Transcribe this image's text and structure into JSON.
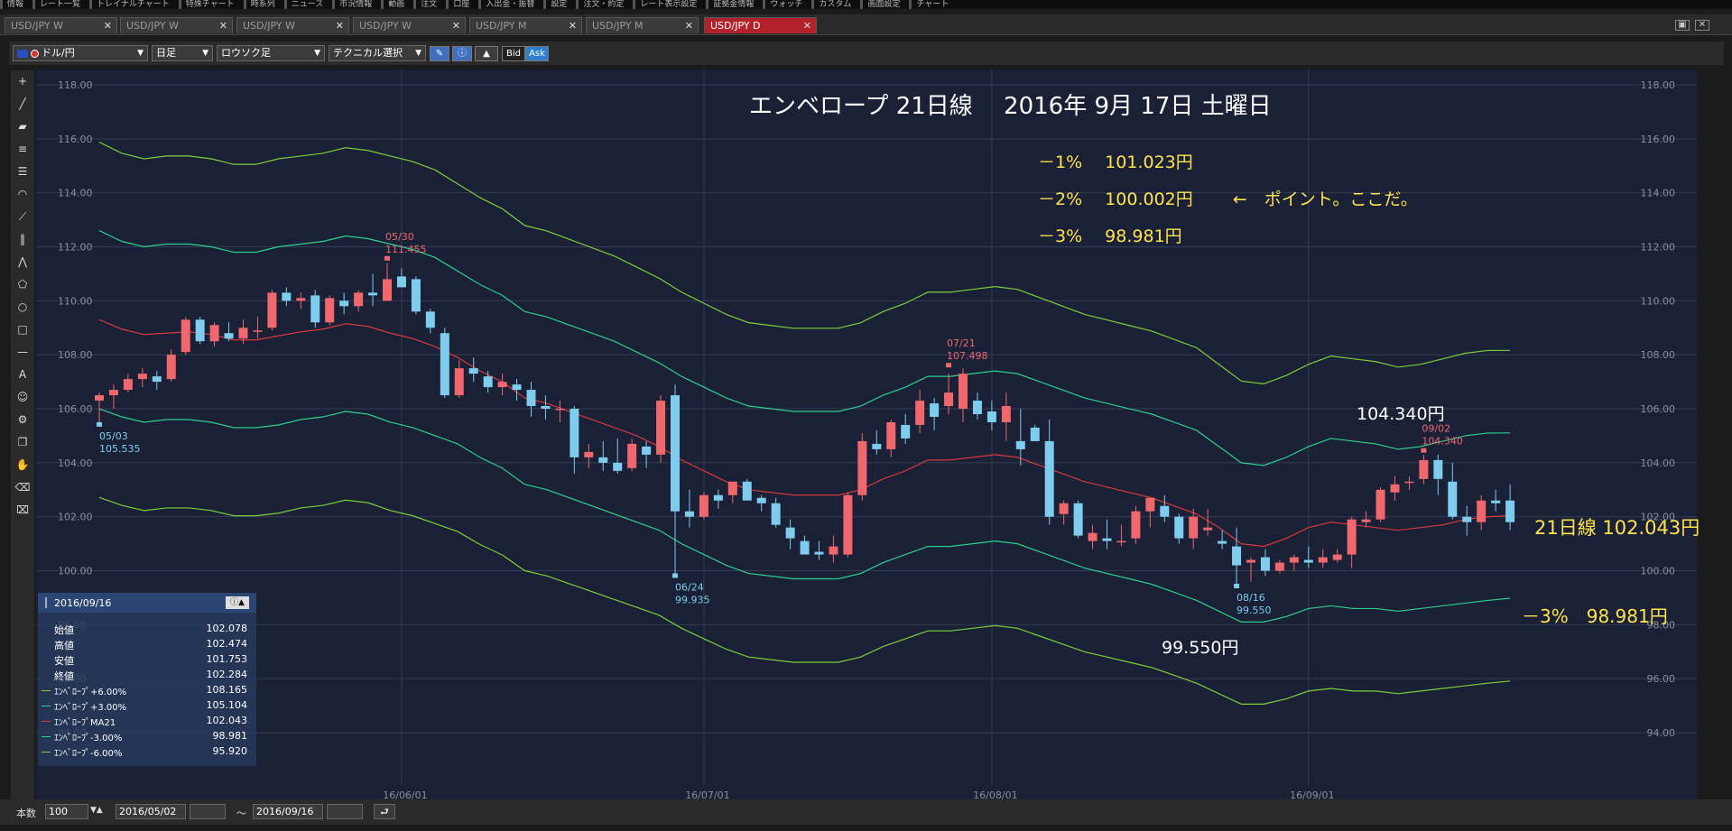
{
  "menubar": {
    "items": [
      "情報",
      "レート一覧",
      "トレイナルチャート",
      "特殊チャート",
      "時系列",
      "ニュース",
      "市況情報",
      "動画",
      "注文",
      "口座",
      "入出金・振替",
      "設定",
      "注文・約定",
      "レート表示設定",
      "証拠金情報",
      "ウォッチ",
      "カスタム",
      "画面設定",
      "チャート"
    ]
  },
  "tabs": [
    {
      "label": "USD/JPY W"
    },
    {
      "label": "USD/JPY W"
    },
    {
      "label": "USD/JPY W"
    },
    {
      "label": "USD/JPY W"
    },
    {
      "label": "USD/JPY M"
    },
    {
      "label": "USD/JPY M"
    },
    {
      "label": "USD/JPY D",
      "active": true
    }
  ],
  "toolbar": {
    "pair": "ドル/円",
    "period": "日足",
    "chart_style": "ロウソク足",
    "technical": "テクニカル選択",
    "bid": "Bid",
    "ask": "Ask"
  },
  "bottombar": {
    "count_label": "本数",
    "count_value": "100",
    "from_date": "2016/05/02",
    "tilde": "～",
    "to_date": "2016/09/16"
  },
  "info_panel": {
    "date": "2016/09/16",
    "rows": [
      {
        "label": "始値",
        "value": "102.078"
      },
      {
        "label": "高値",
        "value": "102.474"
      },
      {
        "label": "安値",
        "value": "101.753"
      },
      {
        "label": "終値",
        "value": "102.284"
      },
      {
        "label": "ｴﾝﾍﾞﾛｰﾌﾟ+6.00%",
        "value": "108.165",
        "color": "#7ccf3a"
      },
      {
        "label": "ｴﾝﾍﾞﾛｰﾌﾟ+3.00%",
        "value": "105.104",
        "color": "#2ecf8c"
      },
      {
        "label": "ｴﾝﾍﾞﾛｰﾌﾟMA21",
        "value": "102.043",
        "color": "#d63a3a"
      },
      {
        "label": "ｴﾝﾍﾞﾛｰﾌﾟ-3.00%",
        "value": "98.981",
        "color": "#2ecf8c"
      },
      {
        "label": "ｴﾝﾍﾞﾛｰﾌﾟ-6.00%",
        "value": "95.920",
        "color": "#7ccf3a"
      }
    ]
  },
  "annotations": {
    "title": "エンベロープ 21日線　 2016年 9月 17日 土曜日",
    "line1": "－1%　 101.023円",
    "line2": "－2%　 100.002円　　 ←　ポイント。ここだ。",
    "line3": "－3%　 98.981円",
    "high_label": "104.340円",
    "low_label": "99.550円",
    "ma_label": "21日線 102.043円",
    "minus3_label": "－3%　98.981円"
  },
  "chart_data": {
    "type": "candlestick",
    "title": "",
    "ylim": [
      93.2,
      118.2
    ],
    "y_ticks": [
      "118.00",
      "116.00",
      "114.00",
      "112.00",
      "110.00",
      "108.00",
      "106.00",
      "104.00",
      "102.00",
      "100.00",
      "98.00",
      "96.00",
      "94.00"
    ],
    "x_ticks": [
      {
        "label": "16/06/01",
        "index": 21
      },
      {
        "label": "16/07/01",
        "index": 42
      },
      {
        "label": "16/08/01",
        "index": 62
      },
      {
        "label": "16/09/01",
        "index": 84
      }
    ],
    "grid": true,
    "colors": {
      "up": "#f0686e",
      "down": "#7ecdee",
      "ma21": "#d63a3a",
      "env3": "#2ecf8c",
      "env6": "#7ccf3a"
    },
    "ohlc": [
      [
        106.3,
        106.6,
        105.5,
        106.5
      ],
      [
        106.5,
        106.9,
        106.0,
        106.7
      ],
      [
        106.7,
        107.3,
        106.6,
        107.1
      ],
      [
        107.1,
        107.5,
        106.8,
        107.3
      ],
      [
        107.2,
        107.4,
        106.7,
        107.0
      ],
      [
        107.1,
        108.2,
        107.0,
        108.0
      ],
      [
        108.1,
        109.4,
        108.0,
        109.3
      ],
      [
        109.3,
        109.4,
        108.4,
        108.5
      ],
      [
        108.5,
        109.2,
        108.3,
        109.1
      ],
      [
        108.8,
        109.2,
        108.5,
        108.6
      ],
      [
        108.6,
        109.3,
        108.4,
        109.0
      ],
      [
        108.9,
        109.4,
        108.6,
        108.9
      ],
      [
        109.0,
        110.4,
        108.9,
        110.3
      ],
      [
        110.3,
        110.5,
        109.8,
        110.0
      ],
      [
        110.0,
        110.3,
        109.7,
        110.1
      ],
      [
        110.2,
        110.4,
        109.0,
        109.2
      ],
      [
        109.2,
        110.2,
        109.1,
        110.1
      ],
      [
        110.0,
        110.3,
        109.5,
        109.8
      ],
      [
        109.8,
        110.4,
        109.6,
        110.3
      ],
      [
        110.3,
        111.0,
        109.8,
        110.2
      ],
      [
        110.0,
        111.4,
        110.0,
        110.8
      ],
      [
        110.9,
        111.2,
        110.5,
        110.5
      ],
      [
        110.8,
        110.9,
        109.5,
        109.6
      ],
      [
        109.6,
        109.7,
        108.8,
        109.0
      ],
      [
        108.8,
        109.0,
        106.4,
        106.5
      ],
      [
        106.5,
        107.8,
        106.4,
        107.5
      ],
      [
        107.5,
        107.9,
        107.0,
        107.3
      ],
      [
        107.2,
        107.4,
        106.6,
        106.8
      ],
      [
        106.8,
        107.3,
        106.5,
        107.0
      ],
      [
        106.9,
        107.1,
        106.3,
        106.7
      ],
      [
        106.7,
        107.0,
        105.7,
        106.1
      ],
      [
        106.1,
        106.5,
        105.6,
        106.0
      ],
      [
        106.0,
        106.3,
        105.5,
        106.0
      ],
      [
        106.0,
        106.1,
        103.6,
        104.2
      ],
      [
        104.2,
        104.7,
        103.8,
        104.4
      ],
      [
        104.2,
        104.8,
        103.7,
        104.0
      ],
      [
        104.0,
        104.9,
        103.6,
        103.7
      ],
      [
        103.8,
        104.9,
        103.7,
        104.7
      ],
      [
        104.6,
        104.8,
        103.8,
        104.3
      ],
      [
        104.3,
        106.5,
        104.0,
        106.3
      ],
      [
        106.5,
        106.9,
        99.9,
        102.2
      ],
      [
        102.2,
        103.0,
        101.6,
        102.0
      ],
      [
        102.0,
        102.9,
        101.9,
        102.8
      ],
      [
        102.8,
        103.0,
        102.3,
        102.6
      ],
      [
        102.8,
        103.3,
        102.5,
        103.3
      ],
      [
        103.3,
        103.4,
        102.6,
        102.6
      ],
      [
        102.7,
        102.8,
        102.2,
        102.5
      ],
      [
        102.5,
        102.7,
        101.6,
        101.7
      ],
      [
        101.6,
        101.9,
        100.8,
        101.2
      ],
      [
        101.1,
        101.3,
        100.6,
        100.6
      ],
      [
        100.7,
        101.1,
        100.4,
        100.6
      ],
      [
        100.6,
        101.3,
        100.3,
        100.9
      ],
      [
        100.6,
        102.9,
        100.5,
        102.8
      ],
      [
        102.8,
        105.1,
        102.6,
        104.8
      ],
      [
        104.7,
        105.2,
        104.3,
        104.5
      ],
      [
        104.5,
        105.6,
        104.2,
        105.5
      ],
      [
        105.4,
        105.8,
        104.7,
        104.9
      ],
      [
        105.4,
        106.7,
        105.1,
        106.3
      ],
      [
        106.2,
        106.4,
        105.2,
        105.7
      ],
      [
        106.1,
        107.3,
        105.8,
        106.6
      ],
      [
        106.0,
        107.5,
        105.5,
        107.3
      ],
      [
        106.3,
        106.6,
        105.6,
        105.8
      ],
      [
        105.9,
        106.3,
        105.2,
        105.5
      ],
      [
        105.5,
        106.6,
        104.8,
        106.1
      ],
      [
        104.8,
        106.0,
        103.9,
        104.5
      ],
      [
        105.3,
        105.4,
        104.8,
        104.8
      ],
      [
        104.8,
        105.6,
        101.7,
        102.0
      ],
      [
        102.1,
        102.6,
        101.7,
        102.5
      ],
      [
        102.5,
        102.6,
        101.2,
        101.3
      ],
      [
        101.1,
        101.7,
        100.8,
        101.4
      ],
      [
        101.2,
        101.9,
        100.8,
        101.1
      ],
      [
        101.1,
        101.7,
        100.9,
        101.1
      ],
      [
        101.2,
        102.4,
        101.0,
        102.2
      ],
      [
        102.2,
        102.6,
        101.6,
        102.7
      ],
      [
        102.4,
        102.8,
        101.8,
        102.0
      ],
      [
        102.0,
        102.1,
        101.0,
        101.2
      ],
      [
        101.2,
        102.3,
        100.8,
        102.0
      ],
      [
        101.5,
        102.3,
        101.3,
        101.6
      ],
      [
        101.1,
        101.5,
        100.8,
        101.0
      ],
      [
        100.9,
        101.6,
        99.5,
        100.2
      ],
      [
        100.3,
        100.5,
        99.6,
        100.4
      ],
      [
        100.5,
        100.8,
        99.8,
        100.0
      ],
      [
        100.0,
        100.4,
        99.9,
        100.3
      ],
      [
        100.3,
        100.6,
        100.0,
        100.5
      ],
      [
        100.4,
        100.9,
        100.1,
        100.3
      ],
      [
        100.3,
        100.8,
        100.1,
        100.5
      ],
      [
        100.4,
        100.8,
        100.3,
        100.6
      ],
      [
        100.6,
        102.0,
        100.1,
        101.9
      ],
      [
        101.8,
        102.2,
        101.6,
        101.9
      ],
      [
        101.9,
        103.1,
        101.8,
        103.0
      ],
      [
        102.9,
        103.5,
        102.6,
        103.2
      ],
      [
        103.3,
        103.5,
        103.0,
        103.3
      ],
      [
        103.4,
        104.3,
        103.2,
        104.1
      ],
      [
        104.1,
        104.3,
        102.8,
        103.4
      ],
      [
        103.3,
        104.0,
        101.9,
        102.0
      ],
      [
        102.0,
        102.4,
        101.3,
        101.8
      ],
      [
        101.8,
        102.8,
        101.5,
        102.6
      ],
      [
        102.6,
        103.0,
        102.2,
        102.5
      ],
      [
        102.6,
        103.2,
        101.5,
        101.8
      ]
    ],
    "ma21": [
      109.3,
      108.95,
      108.75,
      108.8,
      108.85,
      108.75,
      108.55,
      108.55,
      108.7,
      108.85,
      108.95,
      109.15,
      109.05,
      108.8,
      108.6,
      108.3,
      107.9,
      107.4,
      107.0,
      106.4,
      106.2,
      105.9,
      105.6,
      105.3,
      105.0,
      104.6,
      104.1,
      103.7,
      103.3,
      103.0,
      102.9,
      102.8,
      102.8,
      102.8,
      103.0,
      103.4,
      103.7,
      104.1,
      104.1,
      104.2,
      104.3,
      104.2,
      103.9,
      103.6,
      103.3,
      103.1,
      102.9,
      102.7,
      102.4,
      102.1,
      101.6,
      101.0,
      100.9,
      101.2,
      101.6,
      101.8,
      101.7,
      101.6,
      101.5,
      101.6,
      101.7,
      101.9,
      102.0,
      102.04
    ],
    "ma21_start_index": 0,
    "env_plus3": [
      112.6,
      112.2,
      112.0,
      112.1,
      112.1,
      112.0,
      111.8,
      111.8,
      112.0,
      112.1,
      112.2,
      112.4,
      112.3,
      112.1,
      111.9,
      111.6,
      111.1,
      110.6,
      110.2,
      109.6,
      109.4,
      109.1,
      108.8,
      108.5,
      108.1,
      107.7,
      107.2,
      106.8,
      106.4,
      106.1,
      106.0,
      105.9,
      105.9,
      105.9,
      106.1,
      106.5,
      106.8,
      107.2,
      107.2,
      107.3,
      107.4,
      107.3,
      107.0,
      106.7,
      106.4,
      106.2,
      106.0,
      105.8,
      105.5,
      105.2,
      104.6,
      104.0,
      103.9,
      104.2,
      104.6,
      104.9,
      104.8,
      104.7,
      104.5,
      104.6,
      104.8,
      105.0,
      105.1,
      105.104
    ],
    "env_minus3": [
      106.0,
      105.7,
      105.5,
      105.6,
      105.6,
      105.5,
      105.3,
      105.3,
      105.4,
      105.6,
      105.7,
      105.9,
      105.8,
      105.5,
      105.3,
      105.0,
      104.7,
      104.2,
      103.8,
      103.2,
      103.0,
      102.7,
      102.4,
      102.1,
      101.8,
      101.5,
      101.0,
      100.6,
      100.2,
      99.9,
      99.8,
      99.7,
      99.7,
      99.7,
      99.9,
      100.3,
      100.6,
      100.9,
      100.9,
      101.0,
      101.1,
      101.0,
      100.7,
      100.4,
      100.1,
      99.9,
      99.7,
      99.5,
      99.2,
      98.9,
      98.5,
      98.1,
      98.1,
      98.3,
      98.6,
      98.7,
      98.6,
      98.6,
      98.5,
      98.6,
      98.7,
      98.8,
      98.9,
      98.981
    ]
  }
}
